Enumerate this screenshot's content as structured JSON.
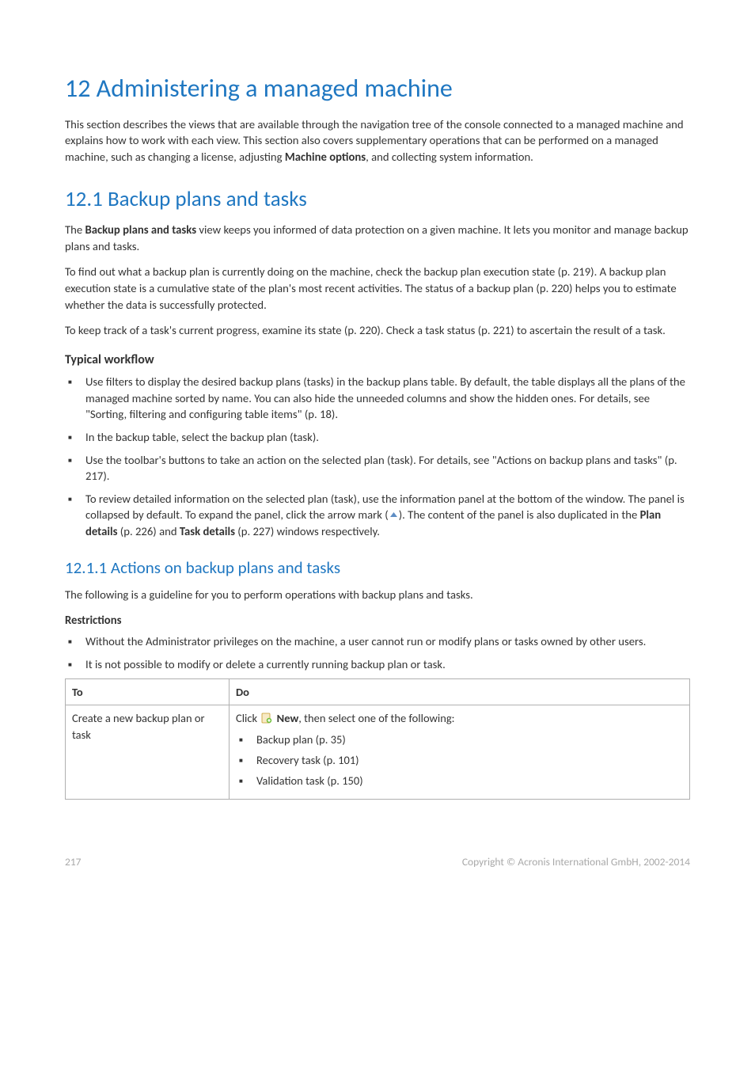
{
  "h1": "12 Administering a managed machine",
  "intro": {
    "p1a": "This section describes the views that are available through the navigation tree of the console connected to a managed machine and explains how to work with each view. This section also covers supplementary operations that can be performed on a managed machine, such as changing a license, adjusting ",
    "p1b": "Machine options",
    "p1c": ", and collecting system information."
  },
  "h2": "12.1  Backup plans and tasks",
  "s12_1": {
    "p1a": "The ",
    "p1b": "Backup plans and tasks",
    "p1c": " view keeps you informed of data protection on a given machine. It lets you monitor and manage backup plans and tasks.",
    "p2": "To find out what a backup plan is currently doing on the machine, check the backup plan execution state (p. 219). A backup plan execution state is a cumulative state of the plan's most recent activities. The status of a backup plan (p. 220) helps you to estimate whether the data is successfully protected.",
    "p3": "To keep track of a task's current progress, examine its state (p. 220). Check a task status (p. 221) to ascertain the result of a task."
  },
  "workflow_h": "Typical workflow",
  "workflow": {
    "b1": "Use filters to display the desired backup plans (tasks) in the backup plans table. By default, the table displays all the plans of the managed machine sorted by name. You can also hide the unneeded columns and show the hidden ones. For details, see \"Sorting, filtering and configuring table items\" (p. 18).",
    "b2": "In the backup table, select the backup plan (task).",
    "b3": "Use the toolbar's buttons to take an action on the selected plan (task). For details, see \"Actions on backup plans and tasks\" (p. 217).",
    "b4a": "To review detailed information on the selected plan (task), use the information panel at the bottom of the window. The panel is collapsed by default. To expand the panel, click the arrow mark (",
    "b4b": "). The content of the panel is also duplicated in the ",
    "b4c": "Plan details",
    "b4d": " (p. 226) and ",
    "b4e": "Task details",
    "b4f": " (p. 227) windows respectively."
  },
  "h3": "12.1.1   Actions on backup plans and tasks",
  "s12_1_1": {
    "p1": "The following is a guideline for you to perform operations with backup plans and tasks.",
    "restrictions_h": "Restrictions",
    "r1": "Without the Administrator privileges on the machine, a user cannot run or modify plans or tasks owned by other users.",
    "r2": "It is not possible to modify or delete a currently running backup plan or task."
  },
  "table": {
    "head_to": "To",
    "head_do": "Do",
    "row1_to": "Create a new backup plan or task",
    "row1_click": "Click ",
    "row1_new": "New",
    "row1_rest": ", then select one of the following:",
    "row1_i1": "Backup plan (p. 35)",
    "row1_i2": "Recovery task (p. 101)",
    "row1_i3": "Validation task (p. 150)"
  },
  "footer": {
    "page": "217",
    "copyright": "Copyright © Acronis International GmbH, 2002-2014"
  }
}
